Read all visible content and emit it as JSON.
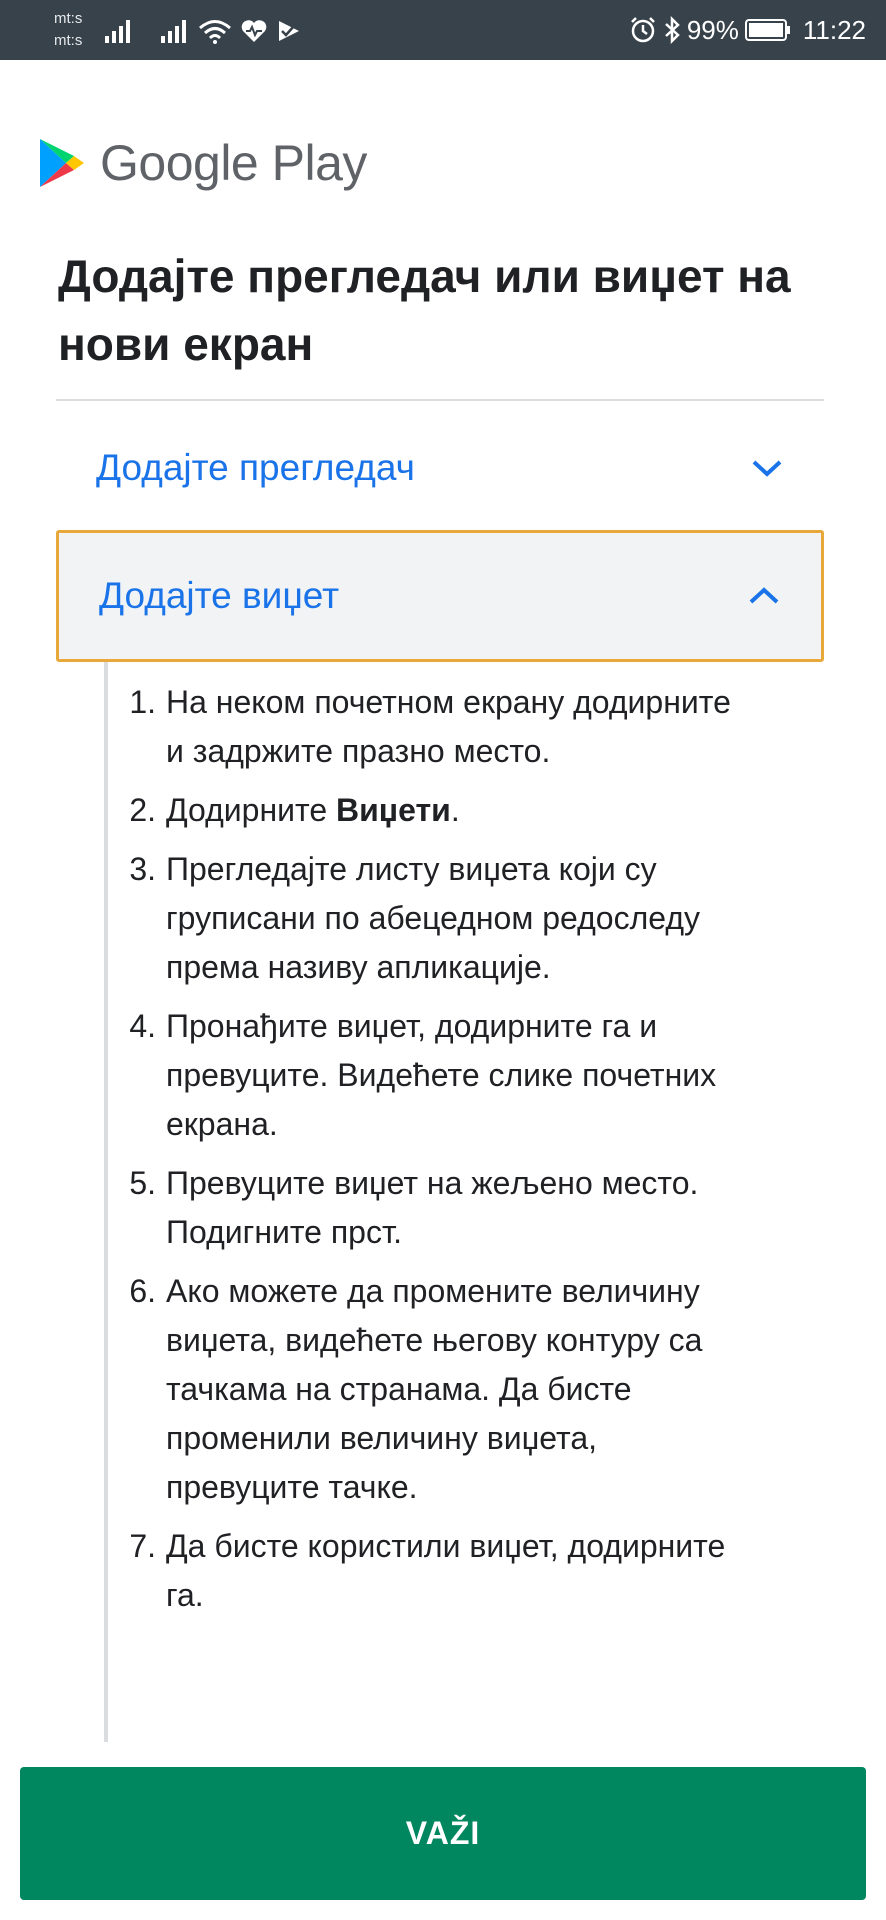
{
  "status_bar": {
    "carrier_1": "mt:s",
    "carrier_2": "mt:s",
    "battery": "99%",
    "time": "11:22",
    "icons": [
      "signal-icon",
      "signal-icon",
      "wifi-icon",
      "health-icon",
      "check-icon",
      "alarm-icon",
      "bluetooth-icon",
      "battery-icon"
    ]
  },
  "brand": {
    "name": "Google Play"
  },
  "title": "Додајте прегледач или виџет на нови екран",
  "accordion": [
    {
      "label": "Додајте прегледач",
      "expanded": false,
      "icon": "chevron-down-icon"
    },
    {
      "label": "Додајте виџет",
      "expanded": true,
      "icon": "chevron-up-icon"
    }
  ],
  "steps": {
    "s1": {
      "num": "1.",
      "text": "На неком почетном екрану додирните и задржите празно место."
    },
    "s2": {
      "num": "2.",
      "pre": "Додирните ",
      "bold": "Виџети",
      "post": "."
    },
    "s3": {
      "num": "3.",
      "text": "Прегледајте листу виџета који су груписани по абецедном редоследу према називу апликације."
    },
    "s4": {
      "num": "4.",
      "text": "Пронађите виџет, додирните га и превуците. Видећете слике почетних екрана."
    },
    "s5": {
      "num": "5.",
      "text": "Превуците виџет на жељено место. Подигните прст."
    },
    "s6": {
      "num": "6.",
      "text": "Ако можете да промените величину виџета, видећете његову контуру са тачкама на странама. Да бисте променили величину виџета, превуците тачке."
    },
    "s7": {
      "num": "7.",
      "text": "Да бисте користили виџет, додирните га."
    }
  },
  "button": {
    "label": "VAŽI"
  },
  "colors": {
    "accent": "#1a73e8",
    "button": "#01875f",
    "focus_border": "#e8a93a",
    "status_bar": "#37424b"
  }
}
